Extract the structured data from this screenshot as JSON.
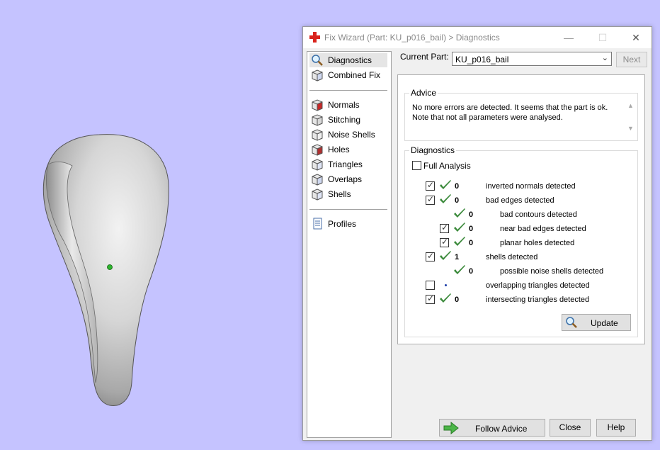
{
  "window": {
    "title": "Fix Wizard (Part: KU_p016_bail) > Diagnostics",
    "controls": {
      "minimize": "—",
      "maximize": "☐",
      "close": "✕"
    }
  },
  "nav": {
    "top": [
      {
        "label": "Diagnostics",
        "icon": "magnifier-icon",
        "selected": true
      },
      {
        "label": "Combined Fix",
        "icon": "cube-stack-icon"
      }
    ],
    "tools": [
      {
        "label": "Normals",
        "icon": "normals-cube-icon"
      },
      {
        "label": "Stitching",
        "icon": "stitching-cube-icon"
      },
      {
        "label": "Noise Shells",
        "icon": "noise-shells-icon"
      },
      {
        "label": "Holes",
        "icon": "holes-cube-icon"
      },
      {
        "label": "Triangles",
        "icon": "triangles-cube-icon"
      },
      {
        "label": "Overlaps",
        "icon": "overlaps-cube-icon"
      },
      {
        "label": "Shells",
        "icon": "shells-cube-icon"
      }
    ],
    "bottom": [
      {
        "label": "Profiles",
        "icon": "document-icon"
      }
    ]
  },
  "current_part": {
    "label": "Current Part:",
    "value": "KU_p016_bail"
  },
  "next_label": "Next",
  "advice": {
    "title": "Advice",
    "line1": "No more errors are detected. It seems that the part is ok.",
    "line2": "Note that not all parameters were analysed."
  },
  "diagnostics": {
    "title": "Diagnostics",
    "full_analysis": {
      "label": "Full Analysis",
      "checked": false
    },
    "rows": [
      {
        "checkbox": true,
        "checked": true,
        "status": "ok",
        "value": "0",
        "label": "inverted normals detected",
        "indent": 0
      },
      {
        "checkbox": true,
        "checked": true,
        "status": "ok",
        "value": "0",
        "label": "bad edges detected",
        "indent": 0
      },
      {
        "checkbox": false,
        "checked": false,
        "status": "ok",
        "value": "0",
        "label": "bad contours detected",
        "indent": 1
      },
      {
        "checkbox": true,
        "checked": true,
        "status": "ok",
        "value": "0",
        "label": "near bad edges detected",
        "indent": 1
      },
      {
        "checkbox": true,
        "checked": true,
        "status": "ok",
        "value": "0",
        "label": "planar holes detected",
        "indent": 1
      },
      {
        "checkbox": true,
        "checked": true,
        "status": "ok",
        "value": "1",
        "label": "shells detected",
        "indent": 0
      },
      {
        "checkbox": false,
        "checked": false,
        "status": "ok",
        "value": "0",
        "label": "possible noise shells detected",
        "indent": 1
      },
      {
        "checkbox": true,
        "checked": false,
        "status": "none",
        "value": "",
        "label": "overlapping triangles detected",
        "indent": 0
      },
      {
        "checkbox": true,
        "checked": true,
        "status": "ok",
        "value": "0",
        "label": "intersecting triangles detected",
        "indent": 0
      }
    ]
  },
  "buttons": {
    "update": "Update",
    "follow_advice": "Follow Advice",
    "close": "Close",
    "help": "Help"
  },
  "colors": {
    "background": "#c5c3ff",
    "check_green": "#3b8a3b",
    "brand_red": "#d9231c"
  }
}
